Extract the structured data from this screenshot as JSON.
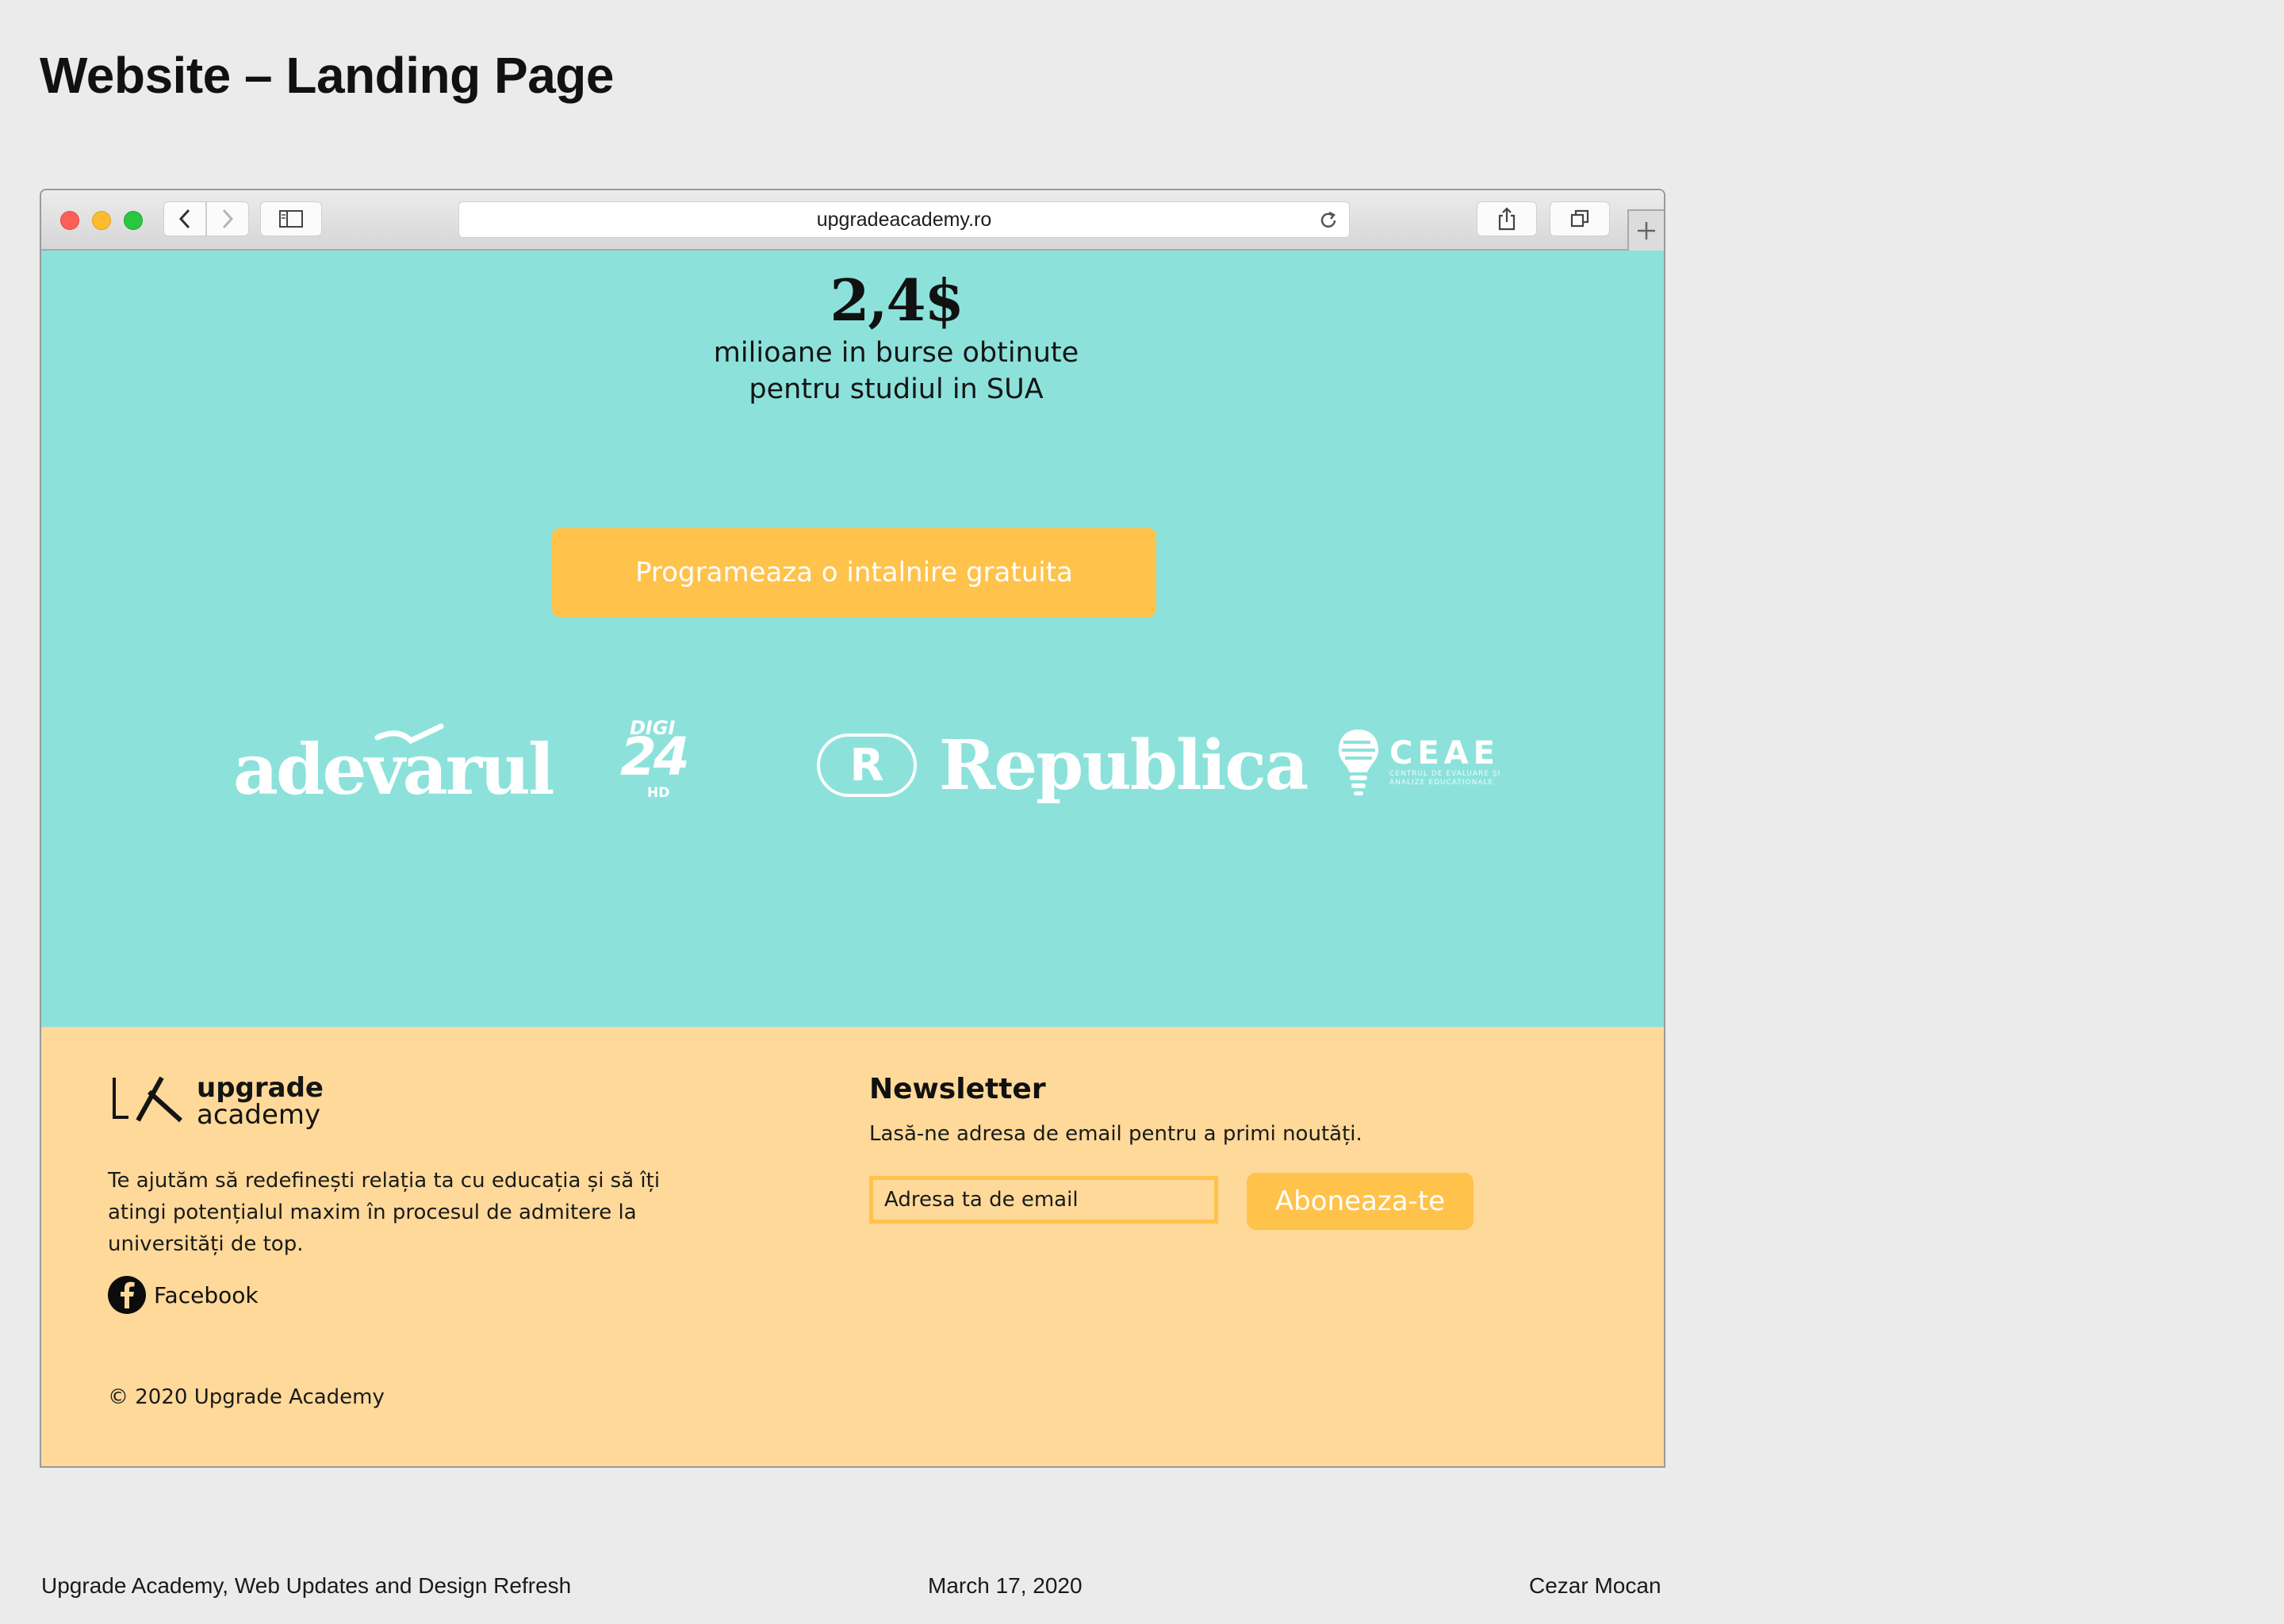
{
  "page": {
    "title": "Website – Landing Page"
  },
  "browser": {
    "url": "upgradeacademy.ro"
  },
  "hero": {
    "stat_value": "2,4$",
    "stat_caption_line1": "milioane in burse obtinute",
    "stat_caption_line2": "pentru studiul in SUA",
    "cta_label": "Programeaza o intalnire gratuita",
    "press_logos": [
      "adevarul",
      "DIGI 24 HD",
      "Republica",
      "CEAE"
    ],
    "digi_top": "DIGI",
    "digi_num": "24",
    "digi_hd": "HD",
    "ceae_main": "CEAE",
    "ceae_sub1": "CENTRUL DE EVALUARE ȘI",
    "ceae_sub2": "ANALIZE EDUCAȚIONALE"
  },
  "footer": {
    "brand_line1": "upgrade",
    "brand_line2": "academy",
    "tagline": "Te ajutăm să redefinești relația ta cu educația și să îți atingi potențialul maxim în procesul de admitere la universități de top.",
    "social_label": "Facebook",
    "copyright": "© 2020 Upgrade Academy",
    "newsletter_title": "Newsletter",
    "newsletter_desc": "Lasă-ne adresa de email pentru a primi noutăți.",
    "email_placeholder": "Adresa ta de email",
    "subscribe_label": "Aboneaza-te"
  },
  "colors": {
    "hero_bg": "#8ce2db",
    "footer_bg": "#ffd999",
    "accent": "#ffc24a"
  },
  "slide_footer": {
    "left": "Upgrade Academy, Web Updates and Design Refresh",
    "center": "March 17, 2020",
    "right": "Cezar Mocan"
  }
}
